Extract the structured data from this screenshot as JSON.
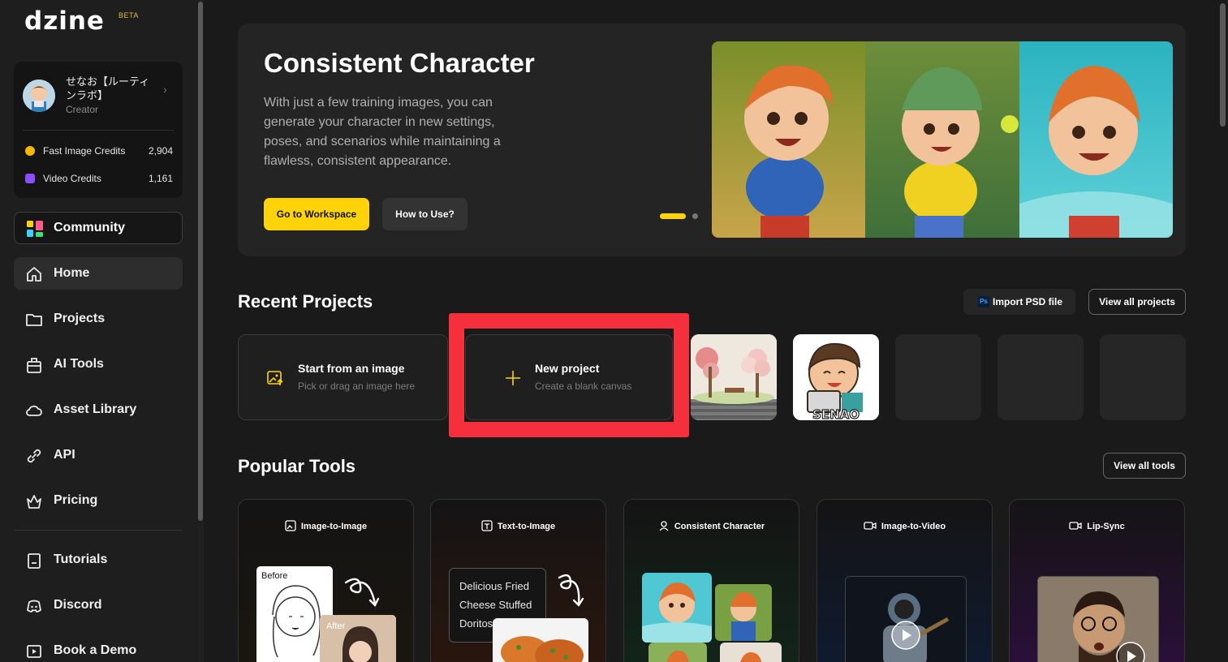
{
  "app": {
    "logo": "dzine",
    "badge": "BETA"
  },
  "user": {
    "name": "せなお【ルーティンラボ】",
    "role": "Creator",
    "credits": [
      {
        "label": "Fast Image Credits",
        "value": "2,904",
        "color": "#f5b800"
      },
      {
        "label": "Video Credits",
        "value": "1,161",
        "color": "#8a4dff"
      }
    ]
  },
  "sidebar": {
    "community": "Community",
    "nav": [
      {
        "label": "Home",
        "icon": "home-icon",
        "active": true
      },
      {
        "label": "Projects",
        "icon": "folder-icon"
      },
      {
        "label": "AI Tools",
        "icon": "toolbox-icon"
      },
      {
        "label": "Asset Library",
        "icon": "cloud-icon"
      },
      {
        "label": "API",
        "icon": "link-icon"
      },
      {
        "label": "Pricing",
        "icon": "crown-icon"
      }
    ],
    "footer": [
      {
        "label": "Tutorials",
        "icon": "tutorials-icon"
      },
      {
        "label": "Discord",
        "icon": "discord-icon"
      },
      {
        "label": "Book a Demo",
        "icon": "demo-icon"
      }
    ]
  },
  "hero": {
    "title": "Consistent Character",
    "description": "With just a few training images, you can generate your character in new settings, poses, and scenarios while maintaining a flawless, consistent appearance.",
    "primary_button": "Go to Workspace",
    "secondary_button": "How to Use?"
  },
  "recent": {
    "title": "Recent Projects",
    "import_button": "Import PSD file",
    "import_badge": "Ps",
    "view_all": "View all projects",
    "start": {
      "title": "Start from an image",
      "subtitle": "Pick or drag an image here"
    },
    "new": {
      "title": "New project",
      "subtitle": "Create a blank canvas"
    },
    "thumb_caption": "SENAO"
  },
  "popular": {
    "title": "Popular Tools",
    "view_all": "View all tools",
    "tools": [
      {
        "label": "Image-to-Image",
        "icon": "image-to-image-icon"
      },
      {
        "label": "Text-to-Image",
        "icon": "text-to-image-icon"
      },
      {
        "label": "Consistent Character",
        "icon": "character-icon"
      },
      {
        "label": "Image-to-Video",
        "icon": "video-icon"
      },
      {
        "label": "Lip-Sync",
        "icon": "lip-sync-icon"
      }
    ],
    "before_label": "Before",
    "after_label": "After",
    "prompt_text": "Delicious Fried Cheese Stuffed Doritos"
  }
}
